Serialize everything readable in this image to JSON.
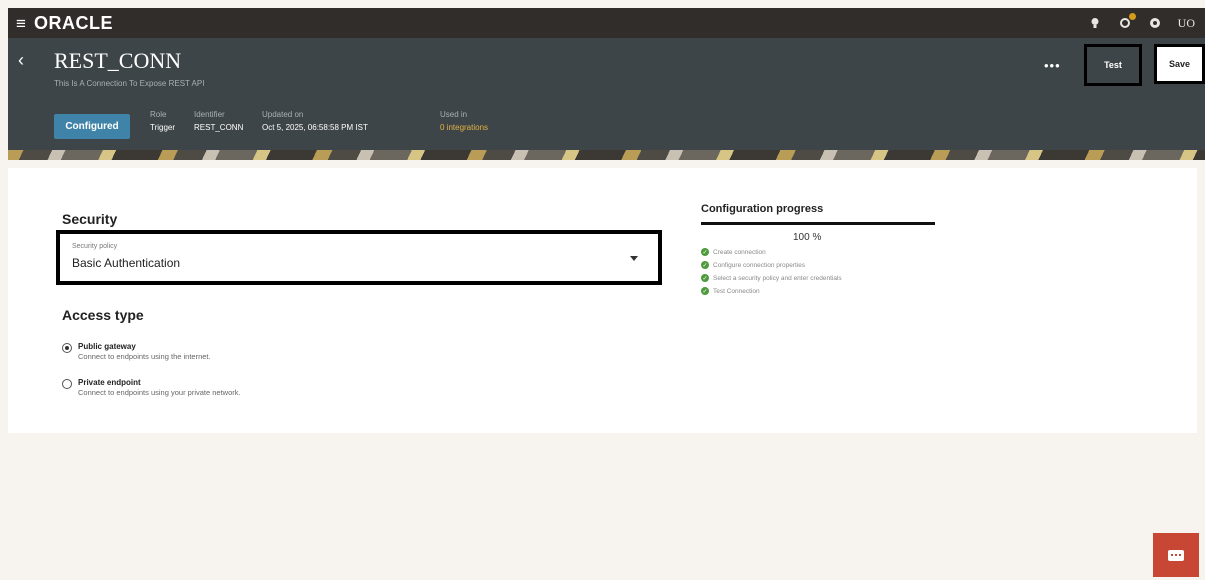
{
  "topbar": {
    "brand": "ORACLE",
    "menu_icon": "hamburger-icon",
    "icons": [
      "lightbulb-icon",
      "notifications-icon",
      "help-icon"
    ],
    "user_initials": "UO"
  },
  "header": {
    "title": "REST_CONN",
    "subtitle": "This Is A Connection To Expose REST API",
    "status": "Configured",
    "meta": [
      {
        "label": "Role",
        "value": "Trigger"
      },
      {
        "label": "Identifier",
        "value": "REST_CONN"
      },
      {
        "label": "Updated on",
        "value": "Oct 5, 2025, 06:58:58 PM IST"
      },
      {
        "label": "Used in",
        "value": "0 integrations"
      }
    ],
    "more_label": "•••",
    "test_label": "Test",
    "save_label": "Save"
  },
  "security": {
    "title": "Security",
    "select_label": "Security policy",
    "select_value": "Basic Authentication"
  },
  "access": {
    "title": "Access type",
    "options": [
      {
        "title": "Public gateway",
        "desc": "Connect to endpoints using the internet.",
        "checked": true
      },
      {
        "title": "Private endpoint",
        "desc": "Connect to endpoints using your private network.",
        "checked": false
      }
    ]
  },
  "progress": {
    "title": "Configuration progress",
    "percent": 100,
    "percent_label": "100 %",
    "steps": [
      "Create connection",
      "Configure connection properties",
      "Select a security policy and enter credentials",
      "Test Connection"
    ]
  },
  "colors": {
    "topbar": "#312d2a",
    "header": "#3e4548",
    "status_badge": "#3f83a8",
    "link": "#e4b341",
    "check": "#4e9a3c",
    "chat": "#c74634"
  }
}
